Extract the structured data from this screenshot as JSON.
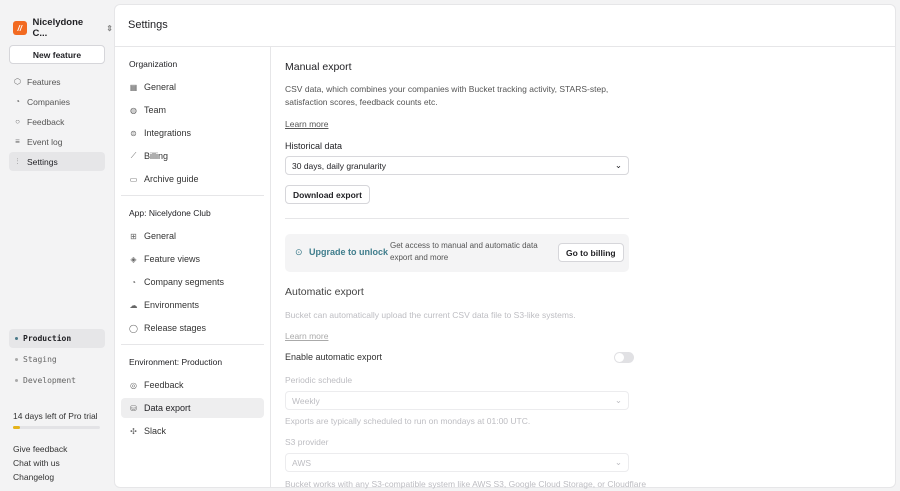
{
  "sidebar": {
    "org": "Nicelydone C...",
    "logo": "//",
    "new_feature": "New feature",
    "items": [
      {
        "label": "Features",
        "icon": "package-icon"
      },
      {
        "label": "Companies",
        "icon": "pie-icon"
      },
      {
        "label": "Feedback",
        "icon": "chat-icon"
      },
      {
        "label": "Event log",
        "icon": "log-icon"
      },
      {
        "label": "Settings",
        "icon": "sliders-icon"
      }
    ],
    "envs": [
      "Production",
      "Staging",
      "Development"
    ],
    "trial": "14 days left of Pro trial",
    "trial_progress": 0.08,
    "links": [
      "Give feedback",
      "Chat with us",
      "Changelog"
    ]
  },
  "header": {
    "title": "Settings"
  },
  "settings_nav": {
    "org_heading": "Organization",
    "org_items": [
      "General",
      "Team",
      "Integrations",
      "Billing",
      "Archive guide"
    ],
    "app_heading": "App: Nicelydone Club",
    "app_items": [
      "General",
      "Feature views",
      "Company segments",
      "Environments",
      "Release stages"
    ],
    "env_heading": "Environment: Production",
    "env_items": [
      "Feedback",
      "Data export",
      "Slack"
    ]
  },
  "manual": {
    "title": "Manual export",
    "desc": "CSV data, which combines your companies with Bucket tracking activity, STARS-step, satisfaction scores, feedback counts etc.",
    "learn": "Learn more",
    "hist_label": "Historical data",
    "hist_value": "30 days, daily granularity",
    "download": "Download export"
  },
  "upgrade": {
    "title": "Upgrade to unlock",
    "desc": "Get access to manual and automatic data export and more",
    "button": "Go to billing"
  },
  "auto": {
    "title": "Automatic export",
    "desc": "Bucket can automatically upload the current CSV data file to S3-like systems.",
    "learn": "Learn more",
    "enable": "Enable automatic export",
    "schedule_label": "Periodic schedule",
    "schedule_value": "Weekly",
    "schedule_help": "Exports are typically scheduled to run on mondays at 01:00 UTC.",
    "provider_label": "S3 provider",
    "provider_value": "AWS",
    "provider_help": "Bucket works with any S3-compatible system like AWS S3, Google Cloud Storage, or Cloudflare"
  }
}
